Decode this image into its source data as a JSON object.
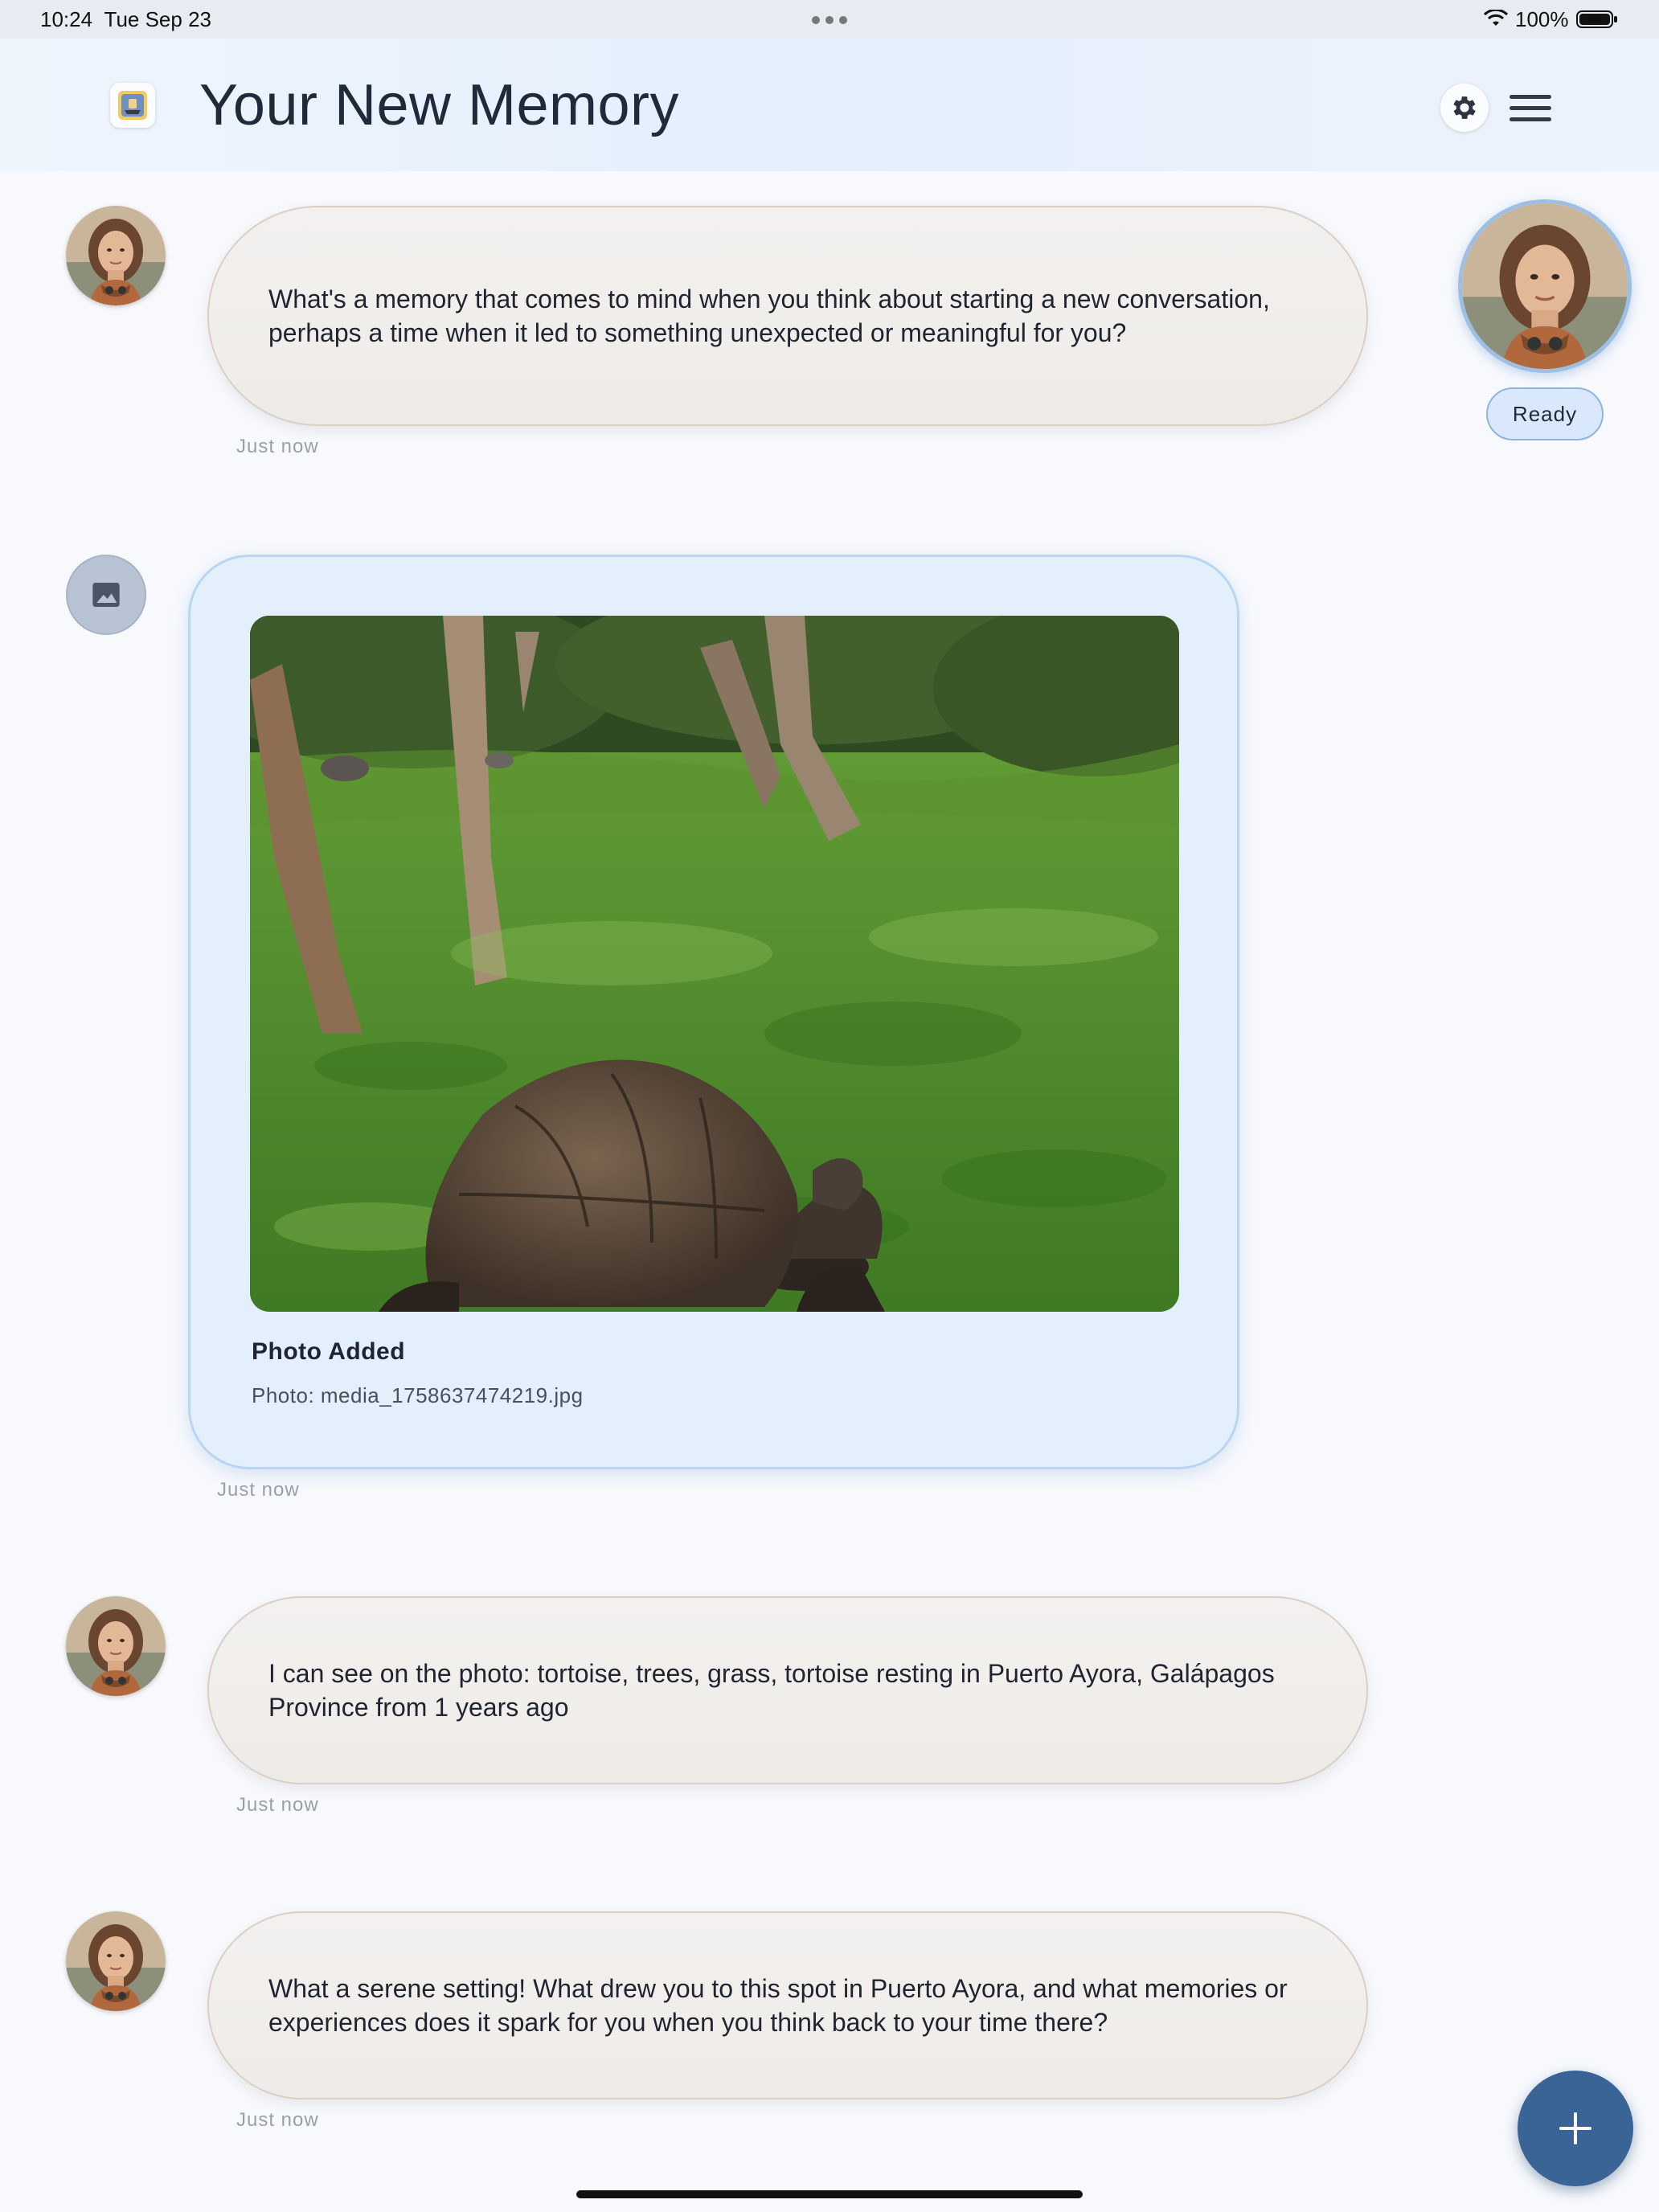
{
  "status_bar": {
    "time": "10:24",
    "date": "Tue Sep 23",
    "battery": "100%"
  },
  "header": {
    "title": "Your New Memory",
    "icons": [
      "app-logo-icon",
      "gear-icon",
      "hamburger-menu-icon"
    ]
  },
  "side_panel": {
    "status": "Ready"
  },
  "messages": [
    {
      "type": "assistant",
      "text": "What's a memory that comes to mind when you think about starting a new conversation, perhaps a time when it led to something unexpected or meaningful for you?",
      "time": "Just now"
    },
    {
      "type": "photo",
      "title": "Photo Added",
      "filename": "Photo: media_1758637474219.jpg",
      "time": "Just now"
    },
    {
      "type": "assistant",
      "text": "I can see on the photo: tortoise, trees, grass, tortoise resting in Puerto Ayora, Galápagos Province from 1 years ago",
      "time": "Just now"
    },
    {
      "type": "assistant",
      "text": "What a serene setting! What drew you to this spot in Puerto Ayora, and what memories or experiences does it spark for you when you think back to your time there?",
      "time": "Just now"
    }
  ],
  "colors": {
    "accent": "#3a6396",
    "bubble": "#efece8",
    "photo_card": "#e3effb"
  }
}
